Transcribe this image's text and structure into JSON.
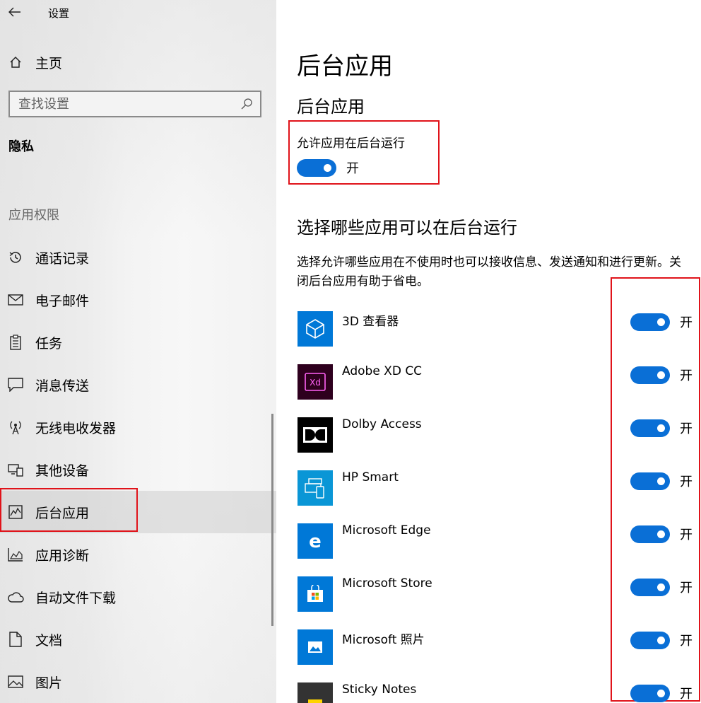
{
  "window": {
    "title": "设置",
    "back_icon": "back-arrow-icon"
  },
  "sidebar": {
    "home_label": "主页",
    "search_placeholder": "查找设置",
    "section_title": "隐私",
    "group_title": "应用权限",
    "items": [
      {
        "label": "通话记录",
        "icon": "call-history-icon"
      },
      {
        "label": "电子邮件",
        "icon": "mail-icon"
      },
      {
        "label": "任务",
        "icon": "tasks-icon"
      },
      {
        "label": "消息传送",
        "icon": "message-icon"
      },
      {
        "label": "无线电收发器",
        "icon": "radio-icon"
      },
      {
        "label": "其他设备",
        "icon": "devices-icon"
      },
      {
        "label": "后台应用",
        "icon": "background-apps-icon",
        "selected": true
      },
      {
        "label": "应用诊断",
        "icon": "diagnostics-icon"
      },
      {
        "label": "自动文件下载",
        "icon": "cloud-icon"
      },
      {
        "label": "文档",
        "icon": "document-icon"
      },
      {
        "label": "图片",
        "icon": "picture-icon"
      }
    ]
  },
  "main": {
    "page_title": "后台应用",
    "subtitle": "后台应用",
    "allow_label": "允许应用在后台运行",
    "allow_state": "开",
    "choose_title": "选择哪些应用可以在后台运行",
    "description": "选择允许哪些应用在不使用时也可以接收信息、发送通知和进行更新。关闭后台应用有助于省电。",
    "apps": [
      {
        "name": "3D 查看器",
        "state": "开",
        "icon": "3d-viewer-icon",
        "color": "#0078d7"
      },
      {
        "name": "Adobe XD CC",
        "state": "开",
        "icon": "adobe-xd-icon",
        "color": "#2e001e"
      },
      {
        "name": "Dolby Access",
        "state": "开",
        "icon": "dolby-icon",
        "color": "#000000"
      },
      {
        "name": "HP Smart",
        "state": "开",
        "icon": "hp-smart-icon",
        "color": "#0a96d6"
      },
      {
        "name": "Microsoft Edge",
        "state": "开",
        "icon": "edge-icon",
        "color": "#0078d7"
      },
      {
        "name": "Microsoft Store",
        "state": "开",
        "icon": "store-icon",
        "color": "#0078d7"
      },
      {
        "name": "Microsoft 照片",
        "state": "开",
        "icon": "photos-icon",
        "color": "#0078d7"
      },
      {
        "name": "Sticky Notes",
        "state": "开",
        "icon": "sticky-notes-icon",
        "color": "#333333"
      }
    ]
  },
  "colors": {
    "accent": "#0a6fd6",
    "highlight_box": "#e0131a"
  }
}
